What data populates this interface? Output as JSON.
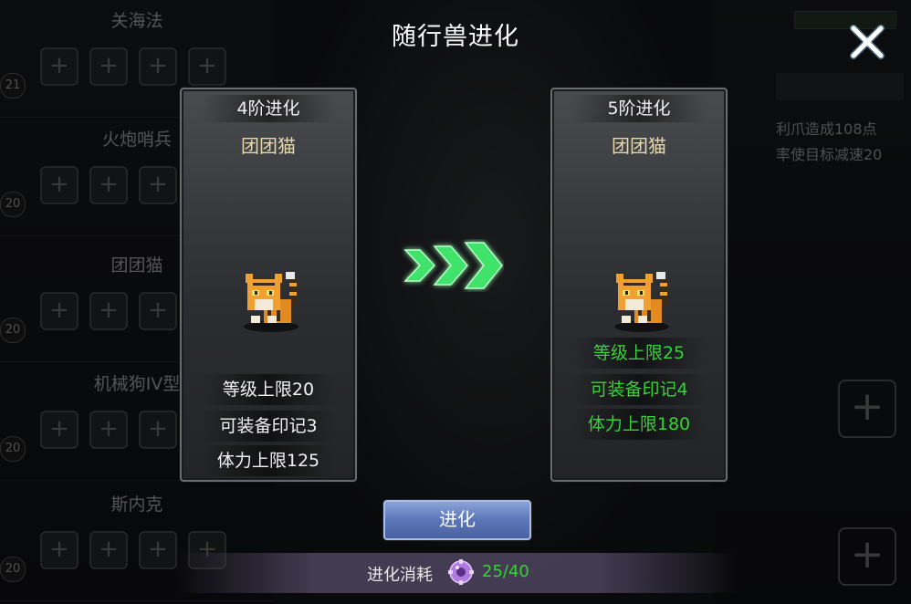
{
  "background": {
    "left_list": [
      {
        "name": "关海法",
        "level": "21"
      },
      {
        "name": "火炮哨兵",
        "level": "20"
      },
      {
        "name": "团团猫",
        "level": "20"
      },
      {
        "name": "机械狗IV型",
        "level": "20"
      },
      {
        "name": "斯内克",
        "level": "20"
      }
    ],
    "right_skill_text": [
      "利爪造成108点",
      "率使目标减速20"
    ]
  },
  "dialog": {
    "title": "随行兽进化",
    "close_icon": "close-x-icon"
  },
  "current": {
    "stage": "4阶进化",
    "pet_name": "团团猫",
    "stats": [
      "等级上限20",
      "可装备印记3",
      "体力上限125"
    ]
  },
  "next": {
    "stage": "5阶进化",
    "pet_name": "团团猫",
    "stats": [
      "等级上限25",
      "可装备印记4",
      "体力上限180"
    ]
  },
  "evolve_button": "进化",
  "cost": {
    "label": "进化消耗",
    "icon": "purple-gear-material-icon",
    "value": "25/40"
  },
  "colors": {
    "stat_upgrade": "#35d335",
    "arrow": "#3fe36a",
    "button": "#5b76b8"
  }
}
